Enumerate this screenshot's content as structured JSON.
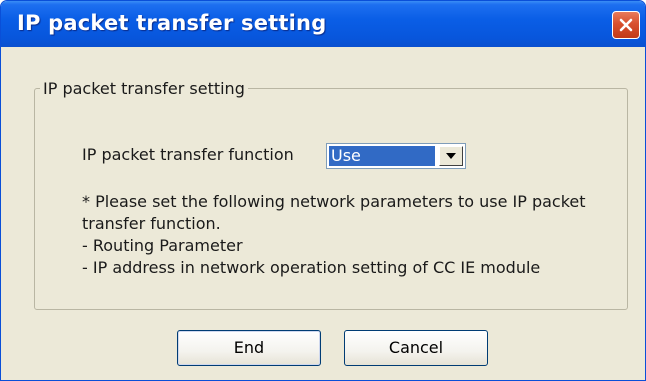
{
  "window": {
    "title": "IP packet transfer setting",
    "close_icon": "close-x-icon"
  },
  "group": {
    "legend": "IP packet transfer setting",
    "function_label": "IP packet transfer function",
    "function_value": "Use",
    "dropdown_icon": "chevron-down-icon",
    "note_lines": [
      "* Please set the following network parameters to use IP packet",
      "transfer function.",
      "- Routing Parameter",
      "- IP address in network operation setting of CC IE module"
    ]
  },
  "buttons": {
    "end_label": "End",
    "cancel_label": "Cancel"
  },
  "colors": {
    "titlebar": "#0a5ee6",
    "close_button": "#d8502e",
    "dialog_background": "#ece9d8",
    "selection": "#316ac5"
  }
}
